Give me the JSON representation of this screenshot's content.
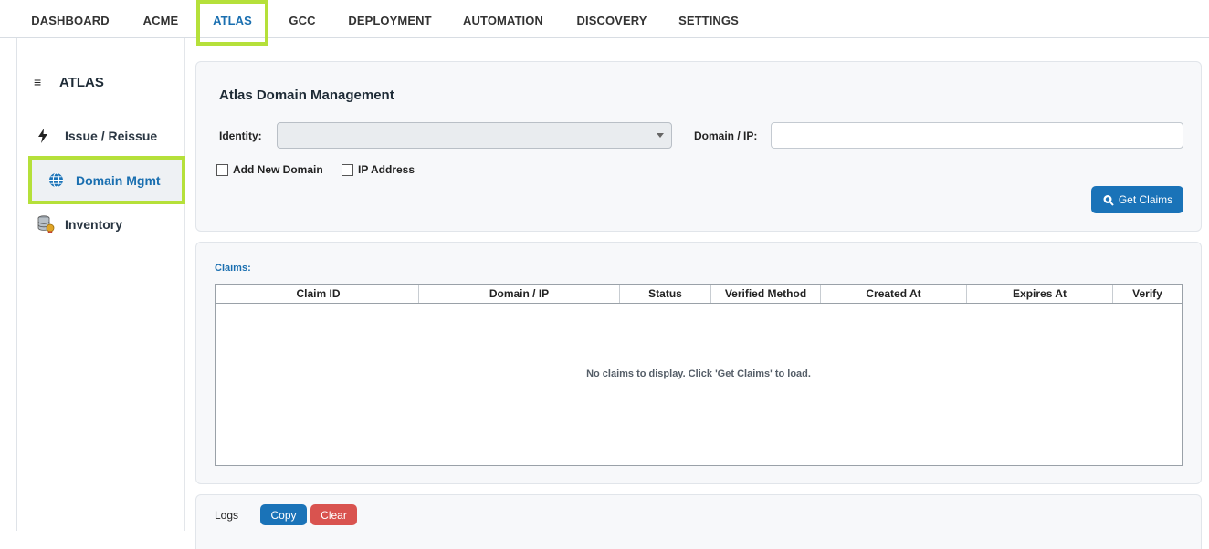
{
  "tabs": [
    {
      "label": "DASHBOARD"
    },
    {
      "label": "ACME"
    },
    {
      "label": "ATLAS"
    },
    {
      "label": "GCC"
    },
    {
      "label": "DEPLOYMENT"
    },
    {
      "label": "AUTOMATION"
    },
    {
      "label": "DISCOVERY"
    },
    {
      "label": "SETTINGS"
    }
  ],
  "active_tab": "ATLAS",
  "sidebar": {
    "title": "ATLAS",
    "menu_icon": "hamburger-icon",
    "items": [
      {
        "label": "Issue / Reissue",
        "icon": "lightning-icon"
      },
      {
        "label": "Domain Mgmt",
        "icon": "globe-icon"
      },
      {
        "label": "Inventory",
        "icon": "database-certificate-icon"
      }
    ],
    "active_item": "Domain Mgmt"
  },
  "domain_card": {
    "title": "Atlas Domain Management",
    "identity_label": "Identity:",
    "identity_value": "",
    "domain_label": "Domain / IP:",
    "domain_value": "",
    "add_new_domain_label": "Add New Domain",
    "add_new_domain_checked": false,
    "ip_address_label": "IP Address",
    "ip_address_checked": false,
    "get_claims_label": "Get Claims",
    "get_claims_icon": "search-icon"
  },
  "claims": {
    "label": "Claims:",
    "columns": [
      "Claim ID",
      "Domain / IP",
      "Status",
      "Verified Method",
      "Created At",
      "Expires At",
      "Verify"
    ],
    "rows": [],
    "empty_message": "No claims to display. Click 'Get Claims' to load."
  },
  "logs": {
    "label": "Logs",
    "copy_label": "Copy",
    "clear_label": "Clear"
  },
  "colors": {
    "accent": "#1a73b8",
    "highlight": "#b5e03a",
    "danger": "#d9534f"
  }
}
